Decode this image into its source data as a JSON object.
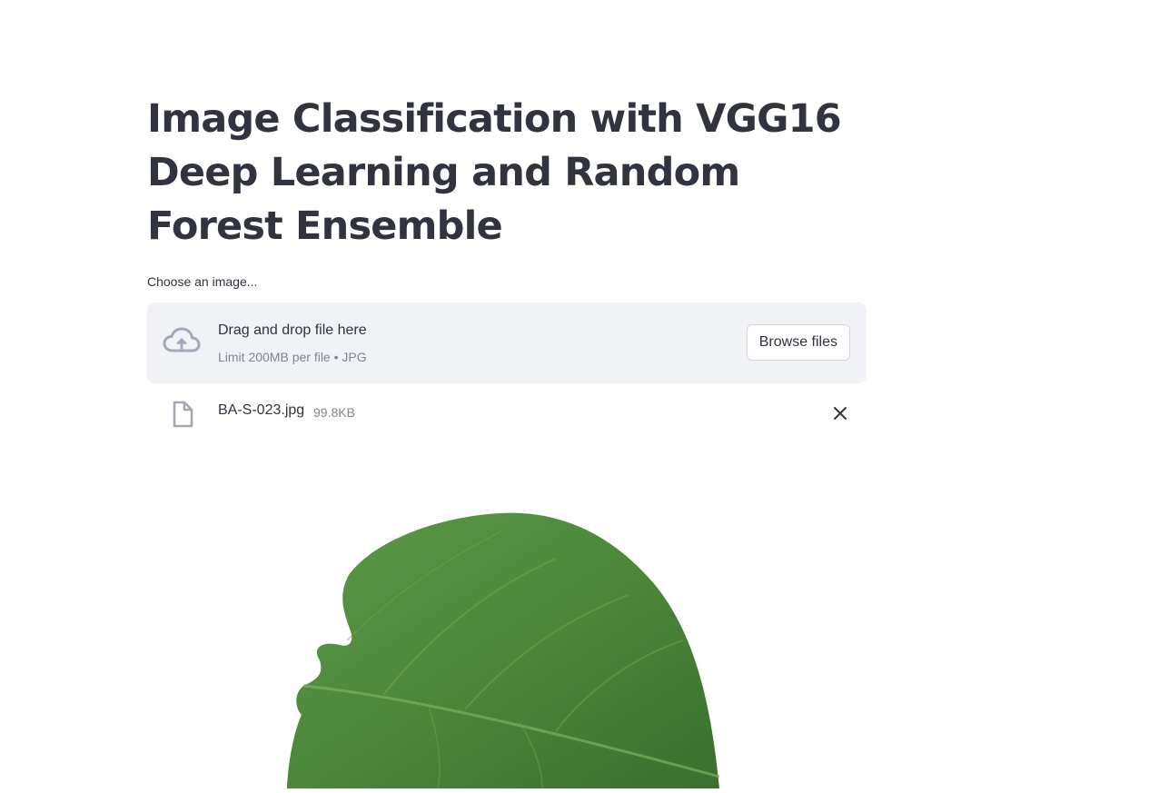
{
  "page": {
    "title": "Image Classification with VGG16 Deep Learning and Random Forest Ensemble"
  },
  "uploader": {
    "label": "Choose an image...",
    "dropzone_title": "Drag and drop file here",
    "dropzone_subtitle": "Limit 200MB per file • JPG",
    "browse_label": "Browse files",
    "icon": "cloud-upload-icon"
  },
  "uploaded_file": {
    "name": "BA-S-023.jpg",
    "size": "99.8KB",
    "icon": "file-icon",
    "remove_icon": "close-icon"
  },
  "preview": {
    "description_icon": "leaf-image"
  },
  "colors": {
    "text": "#31333f",
    "muted": "#808495",
    "dropzone_bg": "#f0f2f6",
    "icon": "#a3a8b8",
    "leaf": "#4e8b3c"
  }
}
